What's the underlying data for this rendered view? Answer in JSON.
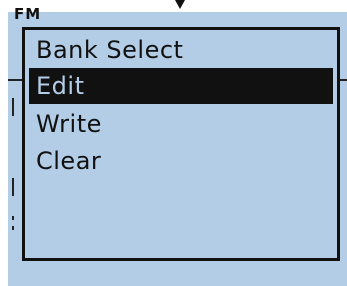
{
  "screen": {
    "mode_label": "FM"
  },
  "menu": {
    "items": [
      {
        "label": "Bank Select",
        "selected": false
      },
      {
        "label": "Edit",
        "selected": true
      },
      {
        "label": "Write",
        "selected": false
      },
      {
        "label": "Clear",
        "selected": false
      }
    ]
  },
  "colors": {
    "lcd_background": "#b3cde6",
    "ink": "#111111"
  },
  "icons": {
    "top_marker": "down-arrow-icon"
  }
}
